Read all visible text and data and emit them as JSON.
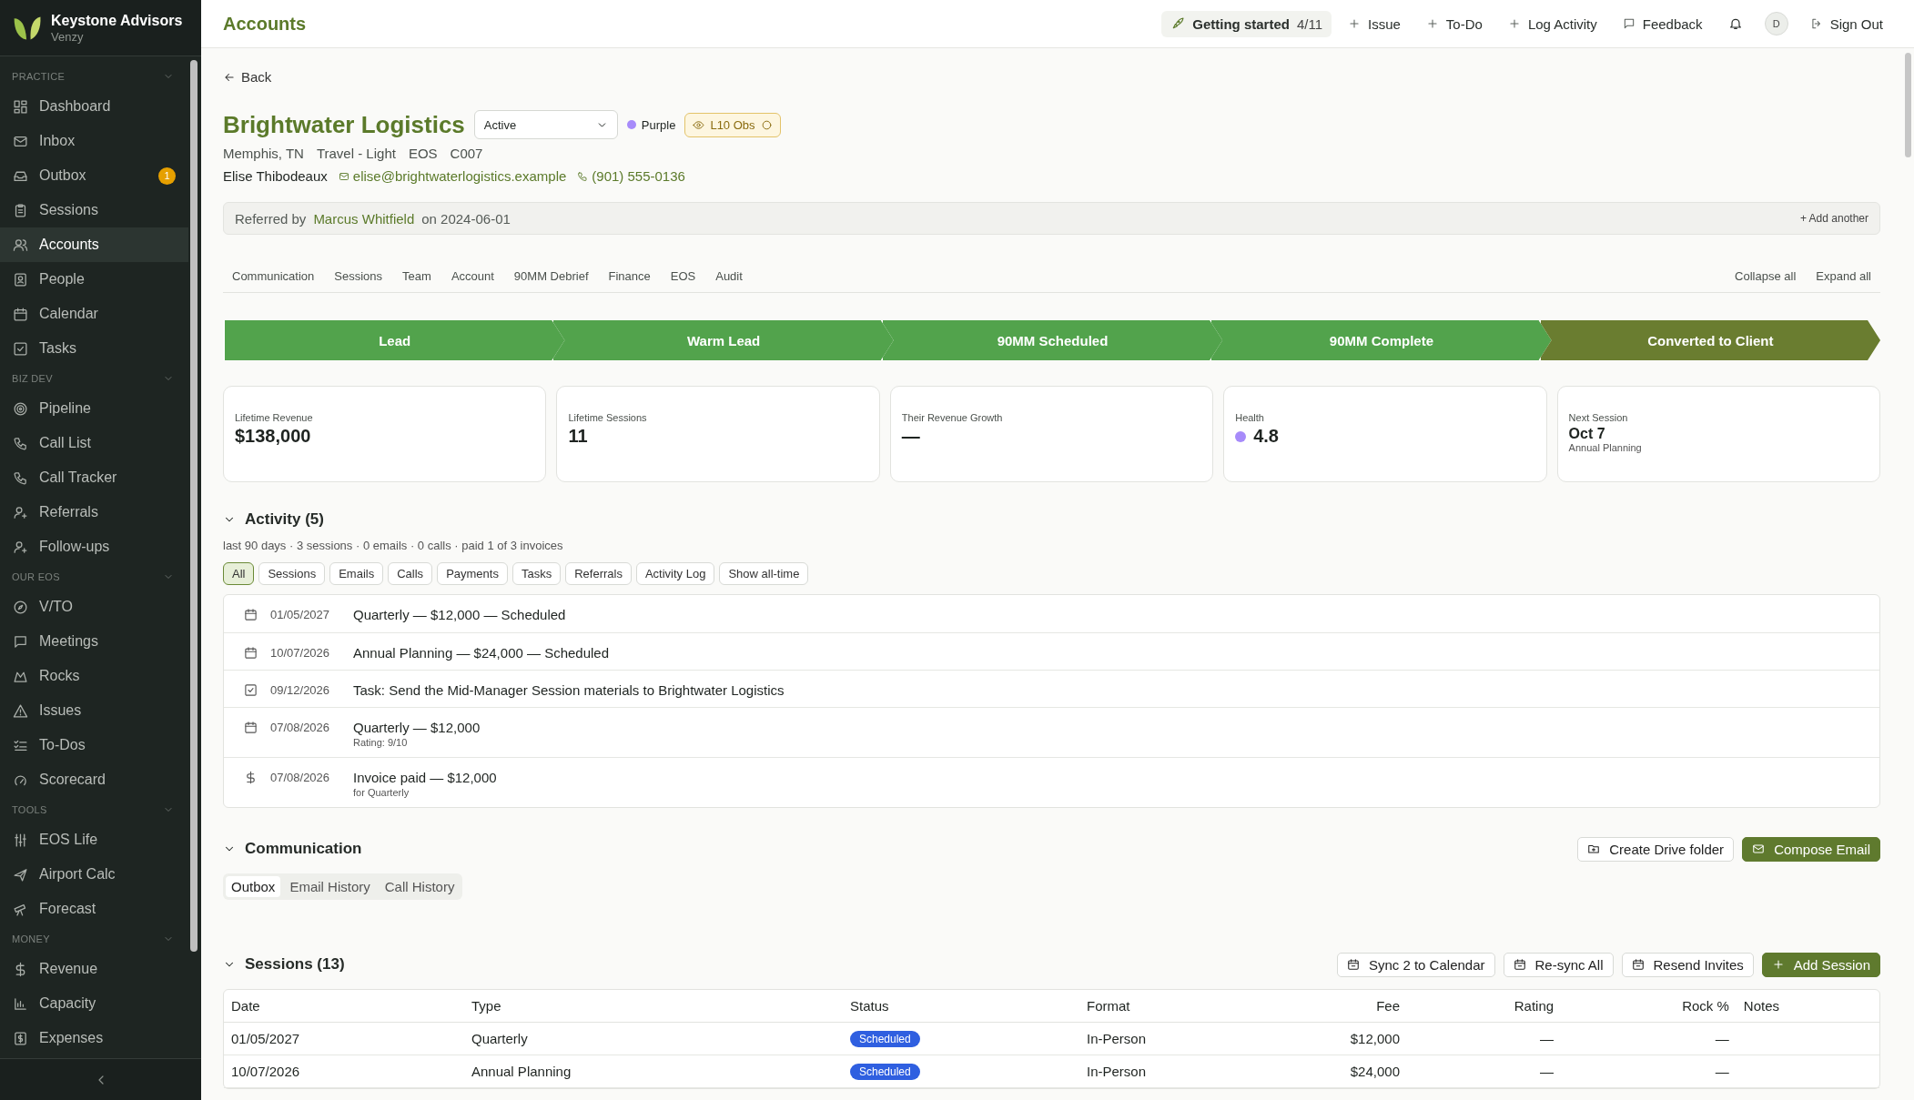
{
  "sidebar": {
    "brand": {
      "name": "Keystone Advisors",
      "subtitle": "Venzy"
    },
    "sections": [
      {
        "title": "PRACTICE",
        "expanded": true,
        "items": [
          {
            "label": "Dashboard",
            "selected": false
          },
          {
            "label": "Inbox",
            "selected": false
          },
          {
            "label": "Outbox",
            "selected": false,
            "badge": "1"
          },
          {
            "label": "Sessions",
            "selected": false
          },
          {
            "label": "Accounts",
            "selected": true
          },
          {
            "label": "People",
            "selected": false
          },
          {
            "label": "Calendar",
            "selected": false
          },
          {
            "label": "Tasks",
            "selected": false
          }
        ]
      },
      {
        "title": "BIZ DEV",
        "expanded": true,
        "items": [
          {
            "label": "Pipeline",
            "selected": false
          },
          {
            "label": "Call List",
            "selected": false
          },
          {
            "label": "Call Tracker",
            "selected": false
          },
          {
            "label": "Referrals",
            "selected": false
          },
          {
            "label": "Follow-ups",
            "selected": false
          }
        ]
      },
      {
        "title": "OUR EOS",
        "expanded": true,
        "items": [
          {
            "label": "V/TO",
            "selected": false
          },
          {
            "label": "Meetings",
            "selected": false
          },
          {
            "label": "Rocks",
            "selected": false
          },
          {
            "label": "Issues",
            "selected": false
          },
          {
            "label": "To-Dos",
            "selected": false
          },
          {
            "label": "Scorecard",
            "selected": false
          }
        ]
      },
      {
        "title": "TOOLS",
        "expanded": true,
        "items": [
          {
            "label": "EOS Life",
            "selected": false
          },
          {
            "label": "Airport Calc",
            "selected": false
          },
          {
            "label": "Forecast",
            "selected": false
          }
        ]
      },
      {
        "title": "MONEY",
        "expanded": true,
        "items": [
          {
            "label": "Revenue",
            "selected": false
          },
          {
            "label": "Capacity",
            "selected": false
          },
          {
            "label": "Expenses",
            "selected": false
          }
        ]
      }
    ]
  },
  "header": {
    "title": "Accounts",
    "getting_started": {
      "label": "Getting started",
      "progress": "4/11"
    },
    "actions": [
      "Issue",
      "To-Do",
      "Log Activity",
      "Feedback"
    ],
    "avatar": "D",
    "sign_out": "Sign Out"
  },
  "back": "Back",
  "account": {
    "name": "Brightwater Logistics",
    "status": "Active",
    "tag": {
      "label": "Purple",
      "color": "#a78bfa"
    },
    "badge": "L10 Obs",
    "meta": [
      "Memphis, TN",
      "Travel - Light",
      "EOS",
      "C007"
    ],
    "contact": {
      "name": "Elise Thibodeaux",
      "email": "elise@brightwaterlogistics.example",
      "phone": "(901) 555-0136"
    }
  },
  "referral": {
    "prefix": "Referred by",
    "name": "Marcus Whitfield",
    "suffix": "on 2024-06-01",
    "action": "+ Add another"
  },
  "section_tabs": [
    "Communication",
    "Sessions",
    "Team",
    "Account",
    "90MM Debrief",
    "Finance",
    "EOS",
    "Audit"
  ],
  "tab_actions": [
    "Collapse all",
    "Expand all"
  ],
  "stages": [
    {
      "label": "Lead",
      "current": false
    },
    {
      "label": "Warm Lead",
      "current": false
    },
    {
      "label": "90MM Scheduled",
      "current": false
    },
    {
      "label": "90MM Complete",
      "current": false
    },
    {
      "label": "Converted to Client",
      "current": true
    }
  ],
  "stats": [
    {
      "label": "Lifetime Revenue",
      "value": "$138,000"
    },
    {
      "label": "Lifetime Sessions",
      "value": "11"
    },
    {
      "label": "Their Revenue Growth",
      "value": "—"
    },
    {
      "label": "Health",
      "value": "4.8",
      "color": "#a78bfa"
    },
    {
      "label": "Next Session",
      "value": "Oct 7",
      "note": "Annual Planning"
    }
  ],
  "activity": {
    "title": "Activity (5)",
    "expanded": true,
    "summary": "last 90 days · 3 sessions · 0 emails · 0 calls · paid 1 of 3 invoices",
    "filters": [
      {
        "label": "All",
        "selected": true
      },
      {
        "label": "Sessions",
        "selected": false
      },
      {
        "label": "Emails",
        "selected": false
      },
      {
        "label": "Calls",
        "selected": false
      },
      {
        "label": "Payments",
        "selected": false
      },
      {
        "label": "Tasks",
        "selected": false
      },
      {
        "label": "Referrals",
        "selected": false
      },
      {
        "label": "Activity Log",
        "selected": false
      },
      {
        "label": "Show all-time",
        "selected": false
      }
    ],
    "items": [
      {
        "kind": "session",
        "date": "01/05/2027",
        "text": "Quarterly — $12,000 — Scheduled"
      },
      {
        "kind": "session",
        "date": "10/07/2026",
        "text": "Annual Planning — $24,000 — Scheduled"
      },
      {
        "kind": "task",
        "date": "09/12/2026",
        "text": "Task: Send the Mid-Manager Session materials to Brightwater Logistics"
      },
      {
        "kind": "session",
        "date": "07/08/2026",
        "text": "Quarterly — $12,000",
        "detail": "Rating: 9/10"
      },
      {
        "kind": "payment",
        "date": "07/08/2026",
        "text": "Invoice paid — $12,000",
        "detail": "for Quarterly"
      }
    ]
  },
  "communication": {
    "title": "Communication",
    "expanded": true,
    "buttons": [
      {
        "label": "Create Drive folder",
        "primary": false
      },
      {
        "label": "Compose Email",
        "primary": true
      }
    ],
    "tabs": [
      {
        "label": "Outbox",
        "selected": true
      },
      {
        "label": "Email History",
        "selected": false
      },
      {
        "label": "Call History",
        "selected": false
      }
    ]
  },
  "sessions": {
    "title": "Sessions (13)",
    "expanded": true,
    "buttons": [
      {
        "label": "Sync 2 to Calendar",
        "primary": false
      },
      {
        "label": "Re-sync All",
        "primary": false
      },
      {
        "label": "Resend Invites",
        "primary": false
      },
      {
        "label": "Add Session",
        "primary": true
      }
    ],
    "columns": [
      {
        "label": "Date",
        "kind": "text"
      },
      {
        "label": "Type",
        "kind": "text"
      },
      {
        "label": "Status",
        "kind": "status"
      },
      {
        "label": "Format",
        "kind": "text"
      },
      {
        "label": "Fee",
        "kind": "num"
      },
      {
        "label": "Rating",
        "kind": "num"
      },
      {
        "label": "Rock %",
        "kind": "num"
      },
      {
        "label": "Notes",
        "kind": "text"
      }
    ],
    "rows": [
      [
        "01/05/2027",
        "Quarterly",
        "Scheduled",
        "In-Person",
        "$12,000",
        "—",
        "—"
      ],
      [
        "10/07/2026",
        "Annual Planning",
        "Scheduled",
        "In-Person",
        "$24,000",
        "—",
        "—"
      ]
    ]
  }
}
